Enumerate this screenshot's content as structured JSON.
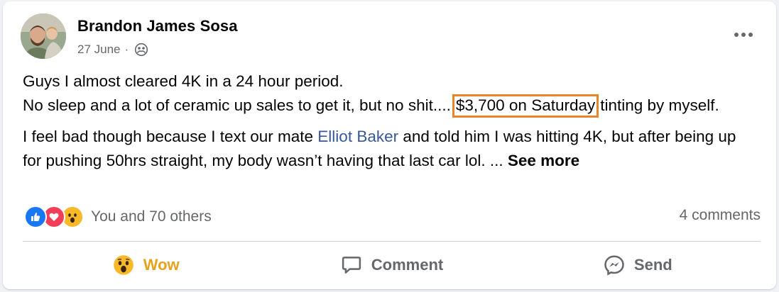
{
  "post": {
    "author": "Brandon James Sosa",
    "date": "27 June",
    "dot": "·",
    "privacy_icon": "friends-icon",
    "text_line1": "Guys I almost cleared 4K in a 24 hour period.",
    "text_line2_a": "No sleep and a lot of ceramic up sales to get it, but no shit....",
    "highlight": "$3,700 on Saturday",
    "text_line2_b": "tinting by myself.",
    "para2_a": "I feel bad though because I text our mate",
    "mention": "Elliot Baker",
    "para2_b": "and told him I was hitting 4K, but after being up for pushing 50hrs straight, my body wasn’t having that last car lol. ...",
    "see_more": "See more"
  },
  "reactions": {
    "types": [
      "like",
      "love",
      "wow"
    ],
    "label": "You and 70 others",
    "comments": "4 comments"
  },
  "actions": {
    "wow": "Wow",
    "comment": "Comment",
    "send": "Send"
  },
  "colors": {
    "highlight_border": "#e8852b",
    "mention": "#385898",
    "wow_active": "#e8a21b"
  }
}
